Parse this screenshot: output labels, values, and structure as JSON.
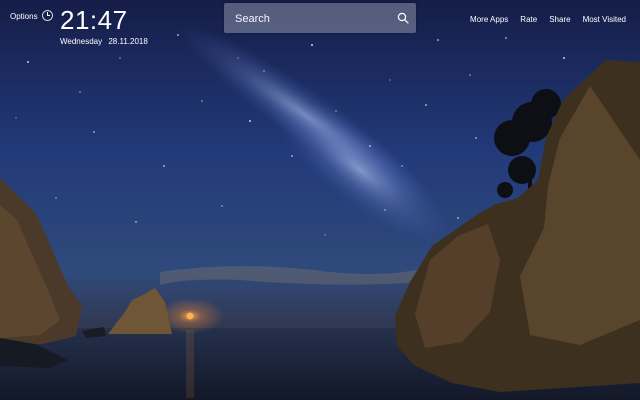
{
  "header": {
    "options_label": "Options",
    "clock_icon": "clock-icon",
    "time": "21:47",
    "weekday": "Wednesday",
    "date": "28.11.2018"
  },
  "search": {
    "placeholder": "Search",
    "icon": "search-icon"
  },
  "nav": {
    "more_apps": "More Apps",
    "rate": "Rate",
    "share": "Share",
    "most_visited": "Most Visited"
  },
  "background": {
    "subject": "night seascape with milky way between rocky cliffs",
    "sky_color": "#1f2f63",
    "water_color": "#1d2438",
    "rock_color": "#4a3a26",
    "moon_color": "#ff8a22"
  }
}
